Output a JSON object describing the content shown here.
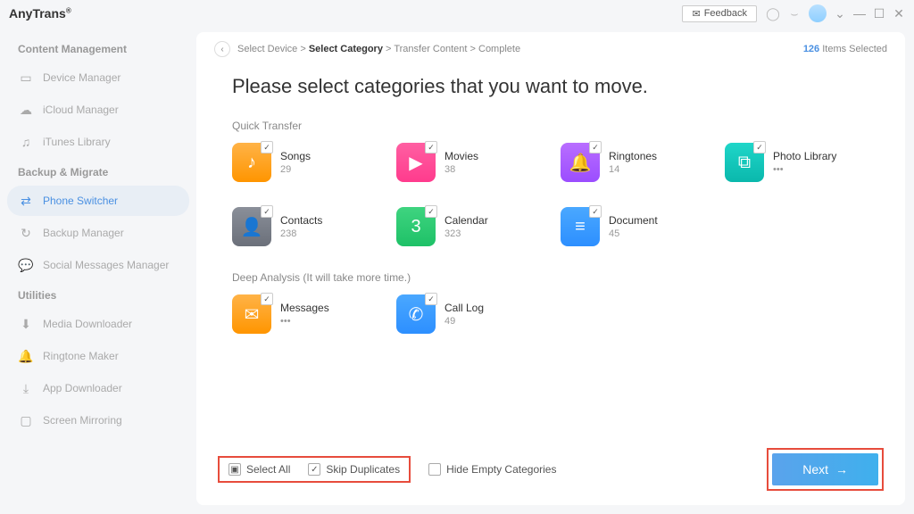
{
  "brand": "AnyTrans",
  "header": {
    "feedback": "Feedback"
  },
  "sidebar": {
    "groups": [
      {
        "title": "Content Management",
        "items": [
          {
            "label": "Device Manager"
          },
          {
            "label": "iCloud Manager"
          },
          {
            "label": "iTunes Library"
          }
        ]
      },
      {
        "title": "Backup & Migrate",
        "items": [
          {
            "label": "Phone Switcher",
            "active": true
          },
          {
            "label": "Backup Manager"
          },
          {
            "label": "Social Messages Manager"
          }
        ]
      },
      {
        "title": "Utilities",
        "items": [
          {
            "label": "Media Downloader"
          },
          {
            "label": "Ringtone Maker"
          },
          {
            "label": "App Downloader"
          },
          {
            "label": "Screen Mirroring"
          }
        ]
      }
    ]
  },
  "breadcrumb": {
    "parts": [
      "Select Device",
      "Select Category",
      "Transfer Content",
      "Complete"
    ],
    "currentIndex": 1,
    "items_count": "126",
    "items_label": "Items Selected"
  },
  "page": {
    "title": "Please select categories that you want to move.",
    "quick_label": "Quick Transfer",
    "deep_label": "Deep Analysis (It will take more time.)"
  },
  "quick": [
    {
      "name": "Songs",
      "count": "29",
      "color": "c-orange",
      "glyph": "♪",
      "checked": true
    },
    {
      "name": "Movies",
      "count": "38",
      "color": "c-pink",
      "glyph": "▶",
      "checked": true
    },
    {
      "name": "Ringtones",
      "count": "14",
      "color": "c-purple",
      "glyph": "🔔",
      "checked": true
    },
    {
      "name": "Photo Library",
      "count": "•••",
      "color": "c-teal",
      "glyph": "⧉",
      "checked": true
    },
    {
      "name": "Contacts",
      "count": "238",
      "color": "c-gray",
      "glyph": "👤",
      "checked": true
    },
    {
      "name": "Calendar",
      "count": "323",
      "color": "c-green",
      "glyph": "3",
      "checked": true
    },
    {
      "name": "Document",
      "count": "45",
      "color": "c-blue",
      "glyph": "≡",
      "checked": true
    }
  ],
  "deep": [
    {
      "name": "Messages",
      "count": "•••",
      "color": "c-orange",
      "glyph": "✉",
      "checked": true
    },
    {
      "name": "Call Log",
      "count": "49",
      "color": "c-blue",
      "glyph": "✆",
      "checked": true
    }
  ],
  "footer": {
    "select_all": "Select All",
    "skip_dup": "Skip Duplicates",
    "hide_empty": "Hide Empty Categories",
    "next": "Next"
  }
}
